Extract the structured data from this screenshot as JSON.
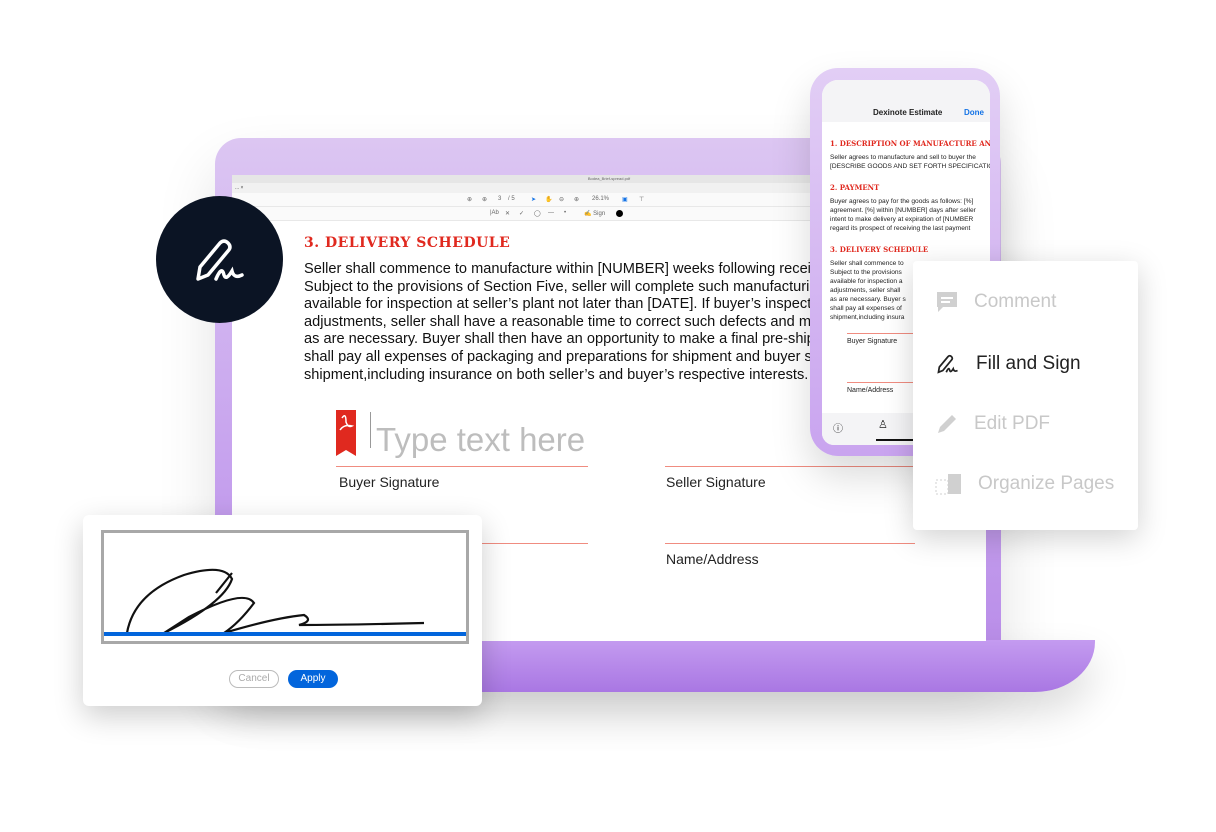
{
  "laptop": {
    "filename": "Bodea_Brief-spread.pdf",
    "tab": "...",
    "toolbar": {
      "page_current": "3",
      "page_total": "/ 5",
      "zoom": "26.1%",
      "sign_label": "Sign"
    },
    "document": {
      "heading": "3. DELIVERY SCHEDULE",
      "paragraph_lines": [
        "Seller shall commence to manufacture within [NUMBER] weeks following receipt",
        "Subject to the provisions of Section Five, seller will complete such manufacturing",
        "available for inspection at seller’s plant not later than [DATE]. If buyer’s inspection",
        "adjustments, seller shall have a reasonable time to correct such defects and make",
        "as are necessary. Buyer shall then have an opportunity to make a final pre-shipment",
        "shall pay all expenses of packaging and preparations for shipment and buyer shall",
        "shipment,including insurance on both seller’s and buyer’s respective interests."
      ],
      "text_field_placeholder": "Type text here",
      "buyer_signature": "Buyer Signature",
      "seller_signature": "Seller Signature",
      "name_address": "Name/Address"
    }
  },
  "phone": {
    "title": "Dexinote Estimate",
    "done": "Done",
    "sections": [
      {
        "heading": "1. DESCRIPTION OF MANUFACTURE AND",
        "lines": [
          "Seller agrees to manufacture and sell to buyer the",
          "[DESCRIBE GOODS AND SET FORTH SPECIFICATIONS"
        ]
      },
      {
        "heading": "2. PAYMENT",
        "lines": [
          "Buyer agrees to pay for the goods as follows: [%]",
          "agreement. [%] within [NUMBER] days after seller",
          "intent to make delivery at expiration of [NUMBER",
          "regard its prospect of receiving the last payment"
        ]
      },
      {
        "heading": "3. DELIVERY SCHEDULE",
        "lines": [
          "Seller shall commence to",
          "Subject to the provisions",
          "available for inspection a",
          "adjustments, seller shall",
          "as are necessary. Buyer s",
          "shall pay all expenses of",
          "shipment,including insura"
        ]
      }
    ],
    "buyer_signature": "Buyer Signature",
    "name_address": "Name/Address"
  },
  "menu": {
    "items": [
      {
        "label": "Comment",
        "icon": "comment-icon",
        "active": false
      },
      {
        "label": "Fill and Sign",
        "icon": "fill-sign-icon",
        "active": true
      },
      {
        "label": "Edit PDF",
        "icon": "pencil-icon",
        "active": false
      },
      {
        "label": "Organize Pages",
        "icon": "organize-pages-icon",
        "active": false
      }
    ]
  },
  "signature_pad": {
    "cancel": "Cancel",
    "apply": "Apply"
  },
  "colors": {
    "accent_red": "#e0291f",
    "blue": "#0265dc",
    "purple": "#c7a3ee",
    "dark": "#0b1424"
  }
}
